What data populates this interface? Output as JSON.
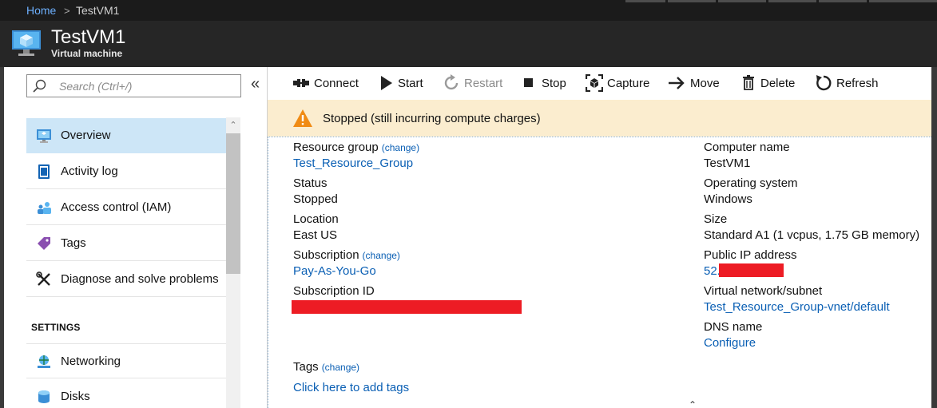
{
  "breadcrumb": {
    "home": "Home",
    "separator": ">",
    "current": "TestVM1"
  },
  "header": {
    "title": "TestVM1",
    "subtitle": "Virtual machine"
  },
  "search": {
    "placeholder": "Search (Ctrl+/)"
  },
  "collapse_glyph": "«",
  "menu": {
    "items": [
      {
        "label": "Overview",
        "icon": "overview-icon",
        "active": true
      },
      {
        "label": "Activity log",
        "icon": "activity-log-icon"
      },
      {
        "label": "Access control (IAM)",
        "icon": "access-control-icon"
      },
      {
        "label": "Tags",
        "icon": "tag-icon"
      },
      {
        "label": "Diagnose and solve problems",
        "icon": "wrench-icon"
      }
    ],
    "settings_header": "SETTINGS",
    "settings_items": [
      {
        "label": "Networking",
        "icon": "networking-icon"
      },
      {
        "label": "Disks",
        "icon": "disks-icon"
      }
    ]
  },
  "commands": {
    "connect": "Connect",
    "start": "Start",
    "restart": "Restart",
    "stop": "Stop",
    "capture": "Capture",
    "move": "Move",
    "delete": "Delete",
    "refresh": "Refresh"
  },
  "banner": {
    "text": "Stopped (still incurring compute charges)",
    "icon": "warning-icon"
  },
  "essentials": {
    "left": {
      "resource_group_label": "Resource group",
      "resource_group_change": "(change)",
      "resource_group_value": "Test_Resource_Group",
      "status_label": "Status",
      "status_value": "Stopped",
      "location_label": "Location",
      "location_value": "East US",
      "subscription_label": "Subscription",
      "subscription_change": "(change)",
      "subscription_value": "Pay-As-You-Go",
      "subscription_id_label": "Subscription ID"
    },
    "right": {
      "computer_name_label": "Computer name",
      "computer_name_value": "TestVM1",
      "os_label": "Operating system",
      "os_value": "Windows",
      "size_label": "Size",
      "size_value": "Standard A1 (1 vcpus, 1.75 GB memory)",
      "public_ip_label": "Public IP address",
      "public_ip_value": "52.",
      "vnet_label": "Virtual network/subnet",
      "vnet_value": "Test_Resource_Group-vnet/default",
      "dns_label": "DNS name",
      "dns_value": "Configure"
    },
    "tags_label": "Tags",
    "tags_change": "(change)",
    "tags_value": "Click here to add tags"
  },
  "colors": {
    "accent_link": "#0a5fb4",
    "banner_bg": "#fbedcf",
    "active_item_bg": "#cde6f7",
    "redaction": "#ed1c24"
  }
}
